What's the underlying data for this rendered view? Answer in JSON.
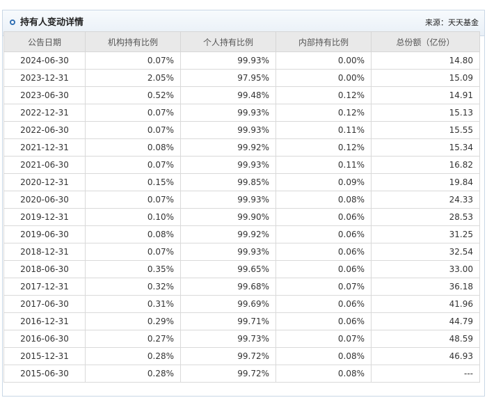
{
  "panel": {
    "title": "持有人变动详情",
    "source": "来源：天天基金"
  },
  "table": {
    "columns": [
      "公告日期",
      "机构持有比例",
      "个人持有比例",
      "内部持有比例",
      "总份额（亿份）"
    ],
    "rows": [
      [
        "2024-06-30",
        "0.07%",
        "99.93%",
        "0.00%",
        "14.80"
      ],
      [
        "2023-12-31",
        "2.05%",
        "97.95%",
        "0.00%",
        "15.09"
      ],
      [
        "2023-06-30",
        "0.52%",
        "99.48%",
        "0.12%",
        "14.91"
      ],
      [
        "2022-12-31",
        "0.07%",
        "99.93%",
        "0.12%",
        "15.13"
      ],
      [
        "2022-06-30",
        "0.07%",
        "99.93%",
        "0.11%",
        "15.55"
      ],
      [
        "2021-12-31",
        "0.08%",
        "99.92%",
        "0.12%",
        "15.34"
      ],
      [
        "2021-06-30",
        "0.07%",
        "99.93%",
        "0.11%",
        "16.82"
      ],
      [
        "2020-12-31",
        "0.15%",
        "99.85%",
        "0.09%",
        "19.84"
      ],
      [
        "2020-06-30",
        "0.07%",
        "99.93%",
        "0.08%",
        "24.33"
      ],
      [
        "2019-12-31",
        "0.10%",
        "99.90%",
        "0.06%",
        "28.53"
      ],
      [
        "2019-06-30",
        "0.08%",
        "99.92%",
        "0.06%",
        "31.25"
      ],
      [
        "2018-12-31",
        "0.07%",
        "99.93%",
        "0.06%",
        "32.54"
      ],
      [
        "2018-06-30",
        "0.35%",
        "99.65%",
        "0.06%",
        "33.00"
      ],
      [
        "2017-12-31",
        "0.32%",
        "99.68%",
        "0.07%",
        "36.18"
      ],
      [
        "2017-06-30",
        "0.31%",
        "99.69%",
        "0.06%",
        "41.96"
      ],
      [
        "2016-12-31",
        "0.29%",
        "99.71%",
        "0.06%",
        "44.79"
      ],
      [
        "2016-06-30",
        "0.27%",
        "99.73%",
        "0.07%",
        "48.59"
      ],
      [
        "2015-12-31",
        "0.28%",
        "99.72%",
        "0.08%",
        "46.93"
      ],
      [
        "2015-06-30",
        "0.28%",
        "99.72%",
        "0.08%",
        "---"
      ]
    ]
  },
  "colors": {
    "accent": "#2f6fb3",
    "header_bg": "#e9e9e9",
    "border": "#d9d9d9"
  }
}
